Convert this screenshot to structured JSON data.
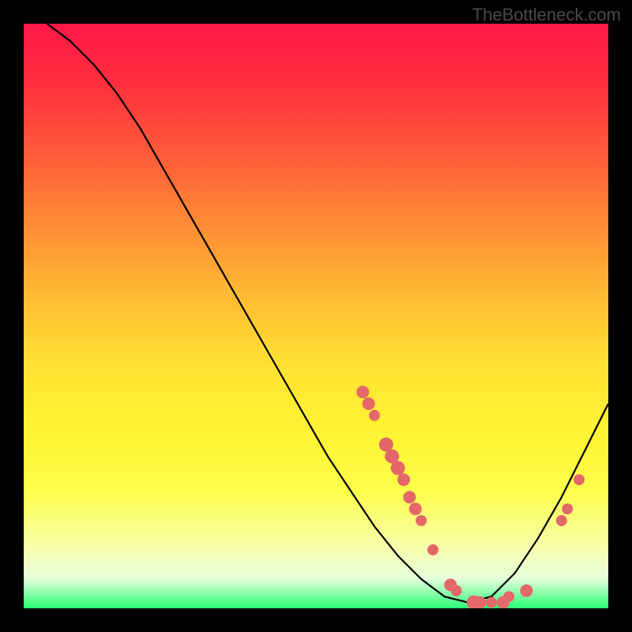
{
  "watermark": "TheBottleneck.com",
  "chart_data": {
    "type": "line",
    "title": "",
    "xlabel": "",
    "ylabel": "",
    "xlim": [
      0,
      100
    ],
    "ylim": [
      0,
      100
    ],
    "grid": false,
    "legend": false,
    "series": [
      {
        "name": "curve",
        "x": [
          4,
          8,
          12,
          16,
          20,
          24,
          28,
          32,
          36,
          40,
          44,
          48,
          52,
          56,
          60,
          64,
          68,
          72,
          76,
          80,
          84,
          88,
          92,
          96,
          100
        ],
        "y": [
          100,
          97,
          93,
          88,
          82,
          75,
          68,
          61,
          54,
          47,
          40,
          33,
          26,
          20,
          14,
          9,
          5,
          2,
          1,
          2,
          6,
          12,
          19,
          27,
          35
        ],
        "color": "#000000"
      }
    ],
    "markers": [
      {
        "x": 58,
        "y": 37,
        "r": 8
      },
      {
        "x": 59,
        "y": 35,
        "r": 8
      },
      {
        "x": 60,
        "y": 33,
        "r": 7
      },
      {
        "x": 62,
        "y": 28,
        "r": 9
      },
      {
        "x": 63,
        "y": 26,
        "r": 9
      },
      {
        "x": 64,
        "y": 24,
        "r": 9
      },
      {
        "x": 65,
        "y": 22,
        "r": 8
      },
      {
        "x": 66,
        "y": 19,
        "r": 8
      },
      {
        "x": 67,
        "y": 17,
        "r": 8
      },
      {
        "x": 68,
        "y": 15,
        "r": 7
      },
      {
        "x": 70,
        "y": 10,
        "r": 7
      },
      {
        "x": 73,
        "y": 4,
        "r": 8
      },
      {
        "x": 74,
        "y": 3,
        "r": 7
      },
      {
        "x": 77,
        "y": 1,
        "r": 9
      },
      {
        "x": 78,
        "y": 1,
        "r": 8
      },
      {
        "x": 80,
        "y": 1,
        "r": 7
      },
      {
        "x": 82,
        "y": 1,
        "r": 8
      },
      {
        "x": 83,
        "y": 2,
        "r": 7
      },
      {
        "x": 86,
        "y": 3,
        "r": 8
      },
      {
        "x": 92,
        "y": 15,
        "r": 7
      },
      {
        "x": 93,
        "y": 17,
        "r": 7
      },
      {
        "x": 95,
        "y": 22,
        "r": 7
      }
    ],
    "marker_color": "#e4676a"
  }
}
